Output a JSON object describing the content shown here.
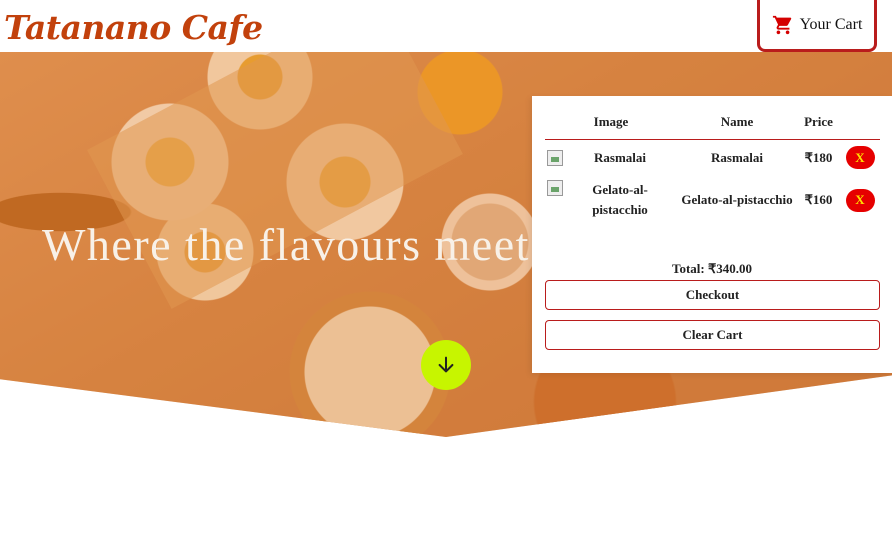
{
  "brand": {
    "name": "Tatanano Cafe"
  },
  "header": {
    "cart_label": "Your Cart",
    "cart_icon": "shopping-cart-icon",
    "accent": "#b91c1c"
  },
  "hero": {
    "title": "Where the flavours meet",
    "scroll_icon": "arrow-down-icon",
    "scroll_button_color": "#c7f500"
  },
  "cart": {
    "columns": [
      "Image",
      "Name",
      "Price"
    ],
    "items": [
      {
        "image_alt": "Rasmalai",
        "name": "Rasmalai",
        "price": "₹180",
        "remove_label": "X"
      },
      {
        "image_alt": "Gelato-al-pistacchio",
        "name": "Gelato-al-pistacchio",
        "price": "₹160",
        "remove_label": "X"
      }
    ],
    "total": "Total: ₹340.00",
    "checkout_label": "Checkout",
    "clear_label": "Clear Cart",
    "remove_color": "#e60000"
  }
}
